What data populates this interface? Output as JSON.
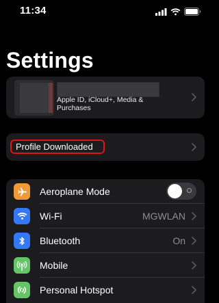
{
  "status_bar": {
    "time": "11:34",
    "icons": [
      "signal-bars-icon",
      "wifi-icon",
      "battery-icon"
    ]
  },
  "page": {
    "title": "Settings"
  },
  "profile": {
    "subtitle": "Apple ID, iCloud+, Media & Purchases"
  },
  "notice": {
    "label": "Profile Downloaded",
    "highlight_color": "#e01414"
  },
  "settings_rows": [
    {
      "label": "Aeroplane Mode",
      "icon": "airplane-icon",
      "icon_color": "#f09a37",
      "control": "toggle",
      "on": false
    },
    {
      "label": "Wi-Fi",
      "icon": "wifi-icon",
      "icon_color": "#3478f6",
      "value": "MGWLAN"
    },
    {
      "label": "Bluetooth",
      "icon": "bluetooth-icon",
      "icon_color": "#3478f6",
      "value": "On"
    },
    {
      "label": "Mobile",
      "icon": "antenna-icon",
      "icon_color": "#65c466"
    },
    {
      "label": "Personal Hotspot",
      "icon": "hotspot-icon",
      "icon_color": "#65c466"
    }
  ]
}
